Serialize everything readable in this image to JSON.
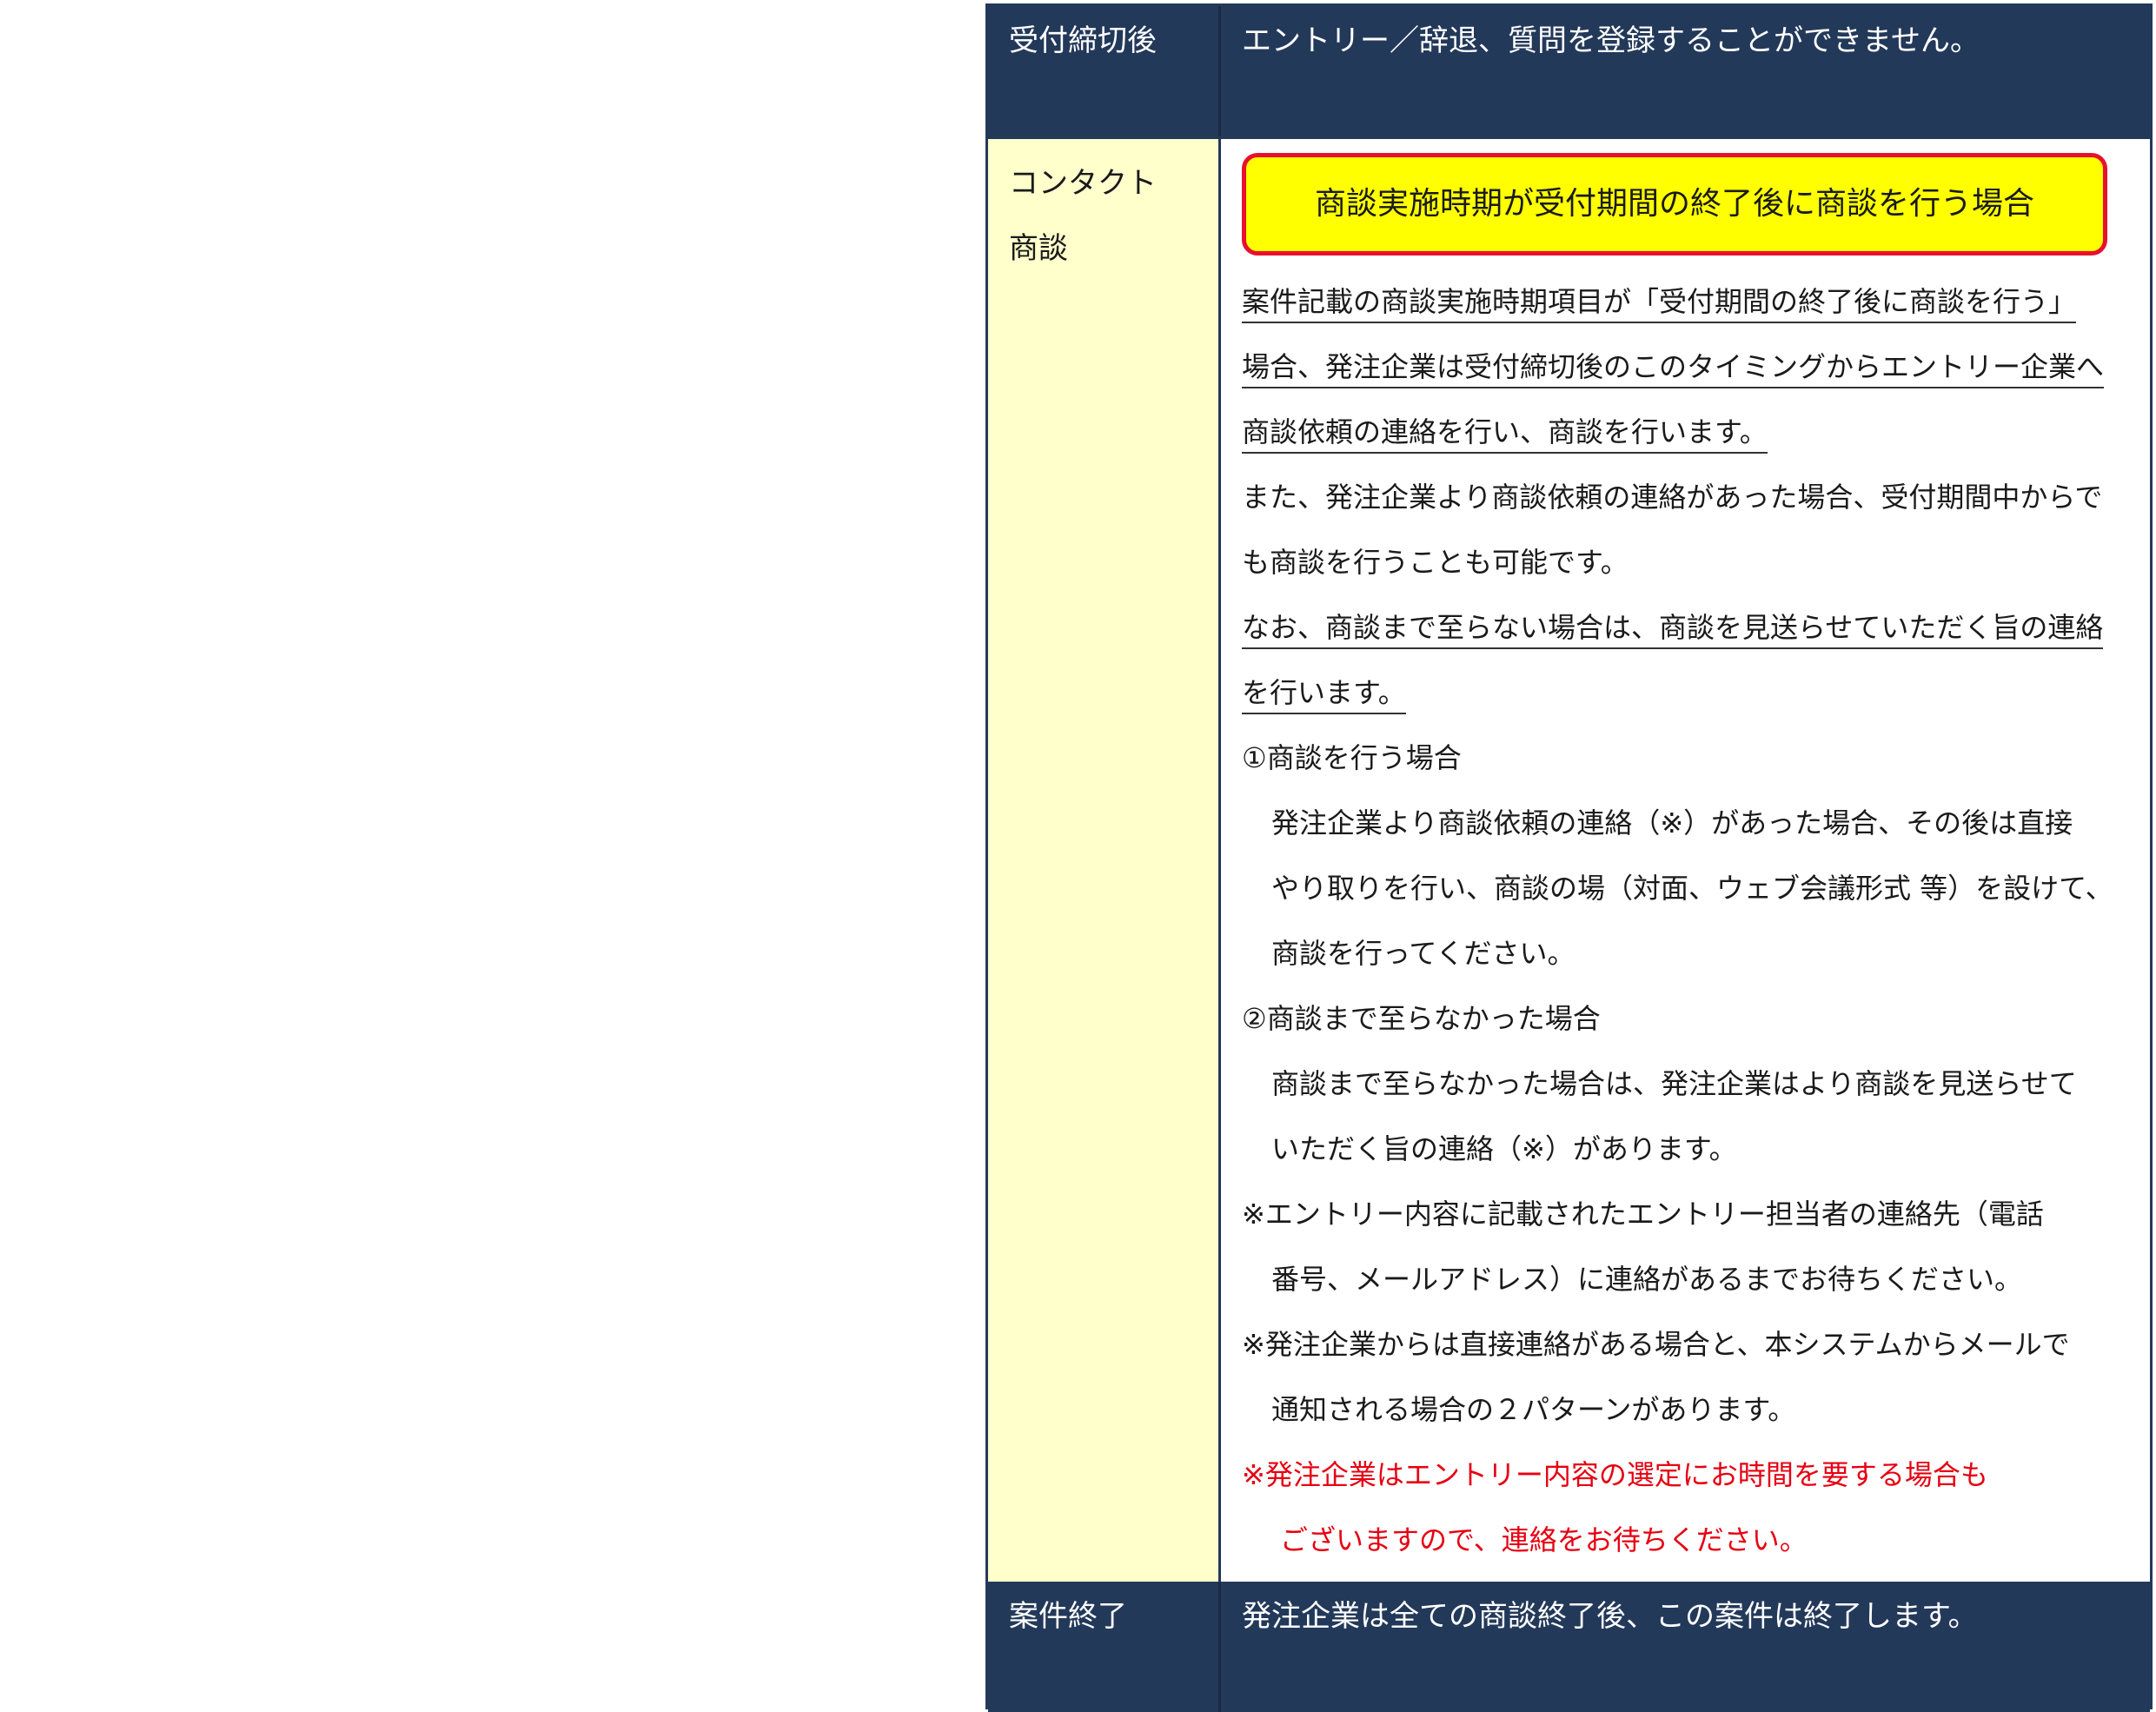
{
  "rows": {
    "closing": {
      "label": "受付締切後",
      "text": "エントリー／辞退、質問を登録することができません。"
    },
    "contact": {
      "label_line1": "コンタクト",
      "label_line2": "商談",
      "callout": "商談実施時期が受付期間の終了後に商談を行う場合",
      "lines": [
        "案件記載の商談実施時期項目が「受付期間の終了後に商談を行う」",
        "場合、発注企業は受付締切後のこのタイミングからエントリー企業へ",
        "商談依頼の連絡を行い、商談を行います。",
        "また、発注企業より商談依頼の連絡があった場合、受付期間中からで",
        "も商談を行うことも可能です。",
        "なお、商談まで至らない場合は、商談を見送らせていただく旨の連絡",
        "を行います。",
        "①商談を行う場合",
        "発注企業より商談依頼の連絡（※）があった場合、その後は直接",
        "やり取りを行い、商談の場（対面、ウェブ会議形式 等）を設けて、",
        "商談を行ってください。",
        "②商談まで至らなかった場合",
        "商談まで至らなかった場合は、発注企業はより商談を見送らせて",
        "いただく旨の連絡（※）があります。",
        "※エントリー内容に記載されたエントリー担当者の連絡先（電話",
        "番号、メールアドレス）に連絡があるまでお待ちください。",
        "※発注企業からは直接連絡がある場合と、本システムからメールで",
        "通知される場合の２パターンがあります。",
        "※発注企業はエントリー内容の選定にお時間を要する場合も",
        "ございますので、連絡をお待ちください。"
      ]
    },
    "end": {
      "label": "案件終了",
      "text": "発注企業は全ての商談終了後、この案件は終了します。"
    }
  },
  "colors": {
    "header_navy": "#23395a",
    "label_yellow_bg": "#ffffcc",
    "callout_yellow": "#ffff00",
    "callout_border_red": "#e8102e",
    "note_red": "#e60012"
  }
}
